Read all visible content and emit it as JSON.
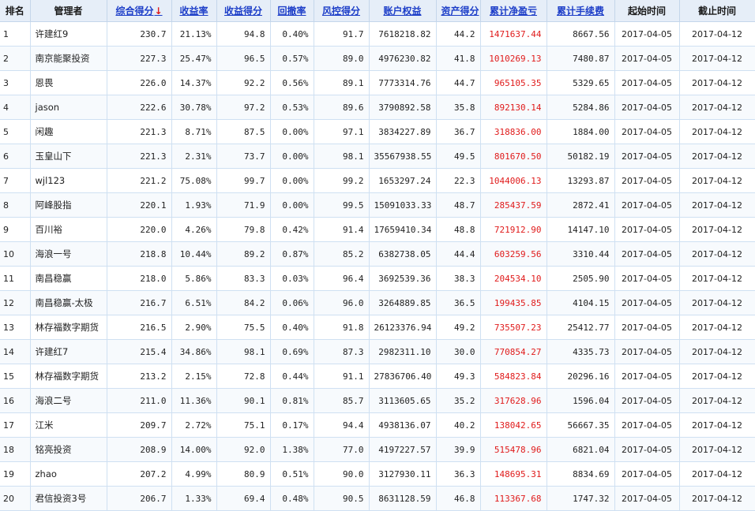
{
  "columns": {
    "rank": "排名",
    "manager": "管理者",
    "composite": "综合得分",
    "composite_arrow": "↓",
    "return_rate": "收益率",
    "return_score": "收益得分",
    "drawdown": "回撤率",
    "risk_score": "风控得分",
    "equity": "账户权益",
    "asset_score": "资产得分",
    "net_pnl": "累计净盈亏",
    "fees": "累计手续费",
    "start_time": "起始时间",
    "end_time": "截止时间"
  },
  "rows": [
    {
      "rank": "1",
      "manager": "许建红9",
      "composite": "230.7",
      "return_rate": "21.13%",
      "return_score": "94.8",
      "drawdown": "0.40%",
      "risk_score": "91.7",
      "equity": "7618218.82",
      "asset_score": "44.2",
      "net_pnl": "1471637.44",
      "fees": "8667.56",
      "start": "2017-04-05",
      "end": "2017-04-12"
    },
    {
      "rank": "2",
      "manager": "南京能聚投资",
      "composite": "227.3",
      "return_rate": "25.47%",
      "return_score": "96.5",
      "drawdown": "0.57%",
      "risk_score": "89.0",
      "equity": "4976230.82",
      "asset_score": "41.8",
      "net_pnl": "1010269.13",
      "fees": "7480.87",
      "start": "2017-04-05",
      "end": "2017-04-12"
    },
    {
      "rank": "3",
      "manager": "恩畏",
      "composite": "226.0",
      "return_rate": "14.37%",
      "return_score": "92.2",
      "drawdown": "0.56%",
      "risk_score": "89.1",
      "equity": "7773314.76",
      "asset_score": "44.7",
      "net_pnl": "965105.35",
      "fees": "5329.65",
      "start": "2017-04-05",
      "end": "2017-04-12"
    },
    {
      "rank": "4",
      "manager": "jason",
      "composite": "222.6",
      "return_rate": "30.78%",
      "return_score": "97.2",
      "drawdown": "0.53%",
      "risk_score": "89.6",
      "equity": "3790892.58",
      "asset_score": "35.8",
      "net_pnl": "892130.14",
      "fees": "5284.86",
      "start": "2017-04-05",
      "end": "2017-04-12"
    },
    {
      "rank": "5",
      "manager": "闲趣",
      "composite": "221.3",
      "return_rate": "8.71%",
      "return_score": "87.5",
      "drawdown": "0.00%",
      "risk_score": "97.1",
      "equity": "3834227.89",
      "asset_score": "36.7",
      "net_pnl": "318836.00",
      "fees": "1884.00",
      "start": "2017-04-05",
      "end": "2017-04-12"
    },
    {
      "rank": "6",
      "manager": "玉皇山下",
      "composite": "221.3",
      "return_rate": "2.31%",
      "return_score": "73.7",
      "drawdown": "0.00%",
      "risk_score": "98.1",
      "equity": "35567938.55",
      "asset_score": "49.5",
      "net_pnl": "801670.50",
      "fees": "50182.19",
      "start": "2017-04-05",
      "end": "2017-04-12"
    },
    {
      "rank": "7",
      "manager": "wjl123",
      "composite": "221.2",
      "return_rate": "75.08%",
      "return_score": "99.7",
      "drawdown": "0.00%",
      "risk_score": "99.2",
      "equity": "1653297.24",
      "asset_score": "22.3",
      "net_pnl": "1044006.13",
      "fees": "13293.87",
      "start": "2017-04-05",
      "end": "2017-04-12"
    },
    {
      "rank": "8",
      "manager": "阿峰股指",
      "composite": "220.1",
      "return_rate": "1.93%",
      "return_score": "71.9",
      "drawdown": "0.00%",
      "risk_score": "99.5",
      "equity": "15091033.33",
      "asset_score": "48.7",
      "net_pnl": "285437.59",
      "fees": "2872.41",
      "start": "2017-04-05",
      "end": "2017-04-12"
    },
    {
      "rank": "9",
      "manager": "百川裕",
      "composite": "220.0",
      "return_rate": "4.26%",
      "return_score": "79.8",
      "drawdown": "0.42%",
      "risk_score": "91.4",
      "equity": "17659410.34",
      "asset_score": "48.8",
      "net_pnl": "721912.90",
      "fees": "14147.10",
      "start": "2017-04-05",
      "end": "2017-04-12"
    },
    {
      "rank": "10",
      "manager": "海浪一号",
      "composite": "218.8",
      "return_rate": "10.44%",
      "return_score": "89.2",
      "drawdown": "0.87%",
      "risk_score": "85.2",
      "equity": "6382738.05",
      "asset_score": "44.4",
      "net_pnl": "603259.56",
      "fees": "3310.44",
      "start": "2017-04-05",
      "end": "2017-04-12"
    },
    {
      "rank": "11",
      "manager": "南昌稳赢",
      "composite": "218.0",
      "return_rate": "5.86%",
      "return_score": "83.3",
      "drawdown": "0.03%",
      "risk_score": "96.4",
      "equity": "3692539.36",
      "asset_score": "38.3",
      "net_pnl": "204534.10",
      "fees": "2505.90",
      "start": "2017-04-05",
      "end": "2017-04-12"
    },
    {
      "rank": "12",
      "manager": "南昌稳赢-太极",
      "composite": "216.7",
      "return_rate": "6.51%",
      "return_score": "84.2",
      "drawdown": "0.06%",
      "risk_score": "96.0",
      "equity": "3264889.85",
      "asset_score": "36.5",
      "net_pnl": "199435.85",
      "fees": "4104.15",
      "start": "2017-04-05",
      "end": "2017-04-12"
    },
    {
      "rank": "13",
      "manager": "林存福数字期货",
      "composite": "216.5",
      "return_rate": "2.90%",
      "return_score": "75.5",
      "drawdown": "0.40%",
      "risk_score": "91.8",
      "equity": "26123376.94",
      "asset_score": "49.2",
      "net_pnl": "735507.23",
      "fees": "25412.77",
      "start": "2017-04-05",
      "end": "2017-04-12"
    },
    {
      "rank": "14",
      "manager": "许建红7",
      "composite": "215.4",
      "return_rate": "34.86%",
      "return_score": "98.1",
      "drawdown": "0.69%",
      "risk_score": "87.3",
      "equity": "2982311.10",
      "asset_score": "30.0",
      "net_pnl": "770854.27",
      "fees": "4335.73",
      "start": "2017-04-05",
      "end": "2017-04-12"
    },
    {
      "rank": "15",
      "manager": "林存福数字期货",
      "composite": "213.2",
      "return_rate": "2.15%",
      "return_score": "72.8",
      "drawdown": "0.44%",
      "risk_score": "91.1",
      "equity": "27836706.40",
      "asset_score": "49.3",
      "net_pnl": "584823.84",
      "fees": "20296.16",
      "start": "2017-04-05",
      "end": "2017-04-12"
    },
    {
      "rank": "16",
      "manager": "海浪二号",
      "composite": "211.0",
      "return_rate": "11.36%",
      "return_score": "90.1",
      "drawdown": "0.81%",
      "risk_score": "85.7",
      "equity": "3113605.65",
      "asset_score": "35.2",
      "net_pnl": "317628.96",
      "fees": "1596.04",
      "start": "2017-04-05",
      "end": "2017-04-12"
    },
    {
      "rank": "17",
      "manager": "江米",
      "composite": "209.7",
      "return_rate": "2.72%",
      "return_score": "75.1",
      "drawdown": "0.17%",
      "risk_score": "94.4",
      "equity": "4938136.07",
      "asset_score": "40.2",
      "net_pnl": "138042.65",
      "fees": "56667.35",
      "start": "2017-04-05",
      "end": "2017-04-12"
    },
    {
      "rank": "18",
      "manager": "铭亮投资",
      "composite": "208.9",
      "return_rate": "14.00%",
      "return_score": "92.0",
      "drawdown": "1.38%",
      "risk_score": "77.0",
      "equity": "4197227.57",
      "asset_score": "39.9",
      "net_pnl": "515478.96",
      "fees": "6821.04",
      "start": "2017-04-05",
      "end": "2017-04-12"
    },
    {
      "rank": "19",
      "manager": "zhao",
      "composite": "207.2",
      "return_rate": "4.99%",
      "return_score": "80.9",
      "drawdown": "0.51%",
      "risk_score": "90.0",
      "equity": "3127930.11",
      "asset_score": "36.3",
      "net_pnl": "148695.31",
      "fees": "8834.69",
      "start": "2017-04-05",
      "end": "2017-04-12"
    },
    {
      "rank": "20",
      "manager": "君信投资3号",
      "composite": "206.7",
      "return_rate": "1.33%",
      "return_score": "69.4",
      "drawdown": "0.48%",
      "risk_score": "90.5",
      "equity": "8631128.59",
      "asset_score": "46.8",
      "net_pnl": "113367.68",
      "fees": "1747.32",
      "start": "2017-04-05",
      "end": "2017-04-12"
    }
  ]
}
